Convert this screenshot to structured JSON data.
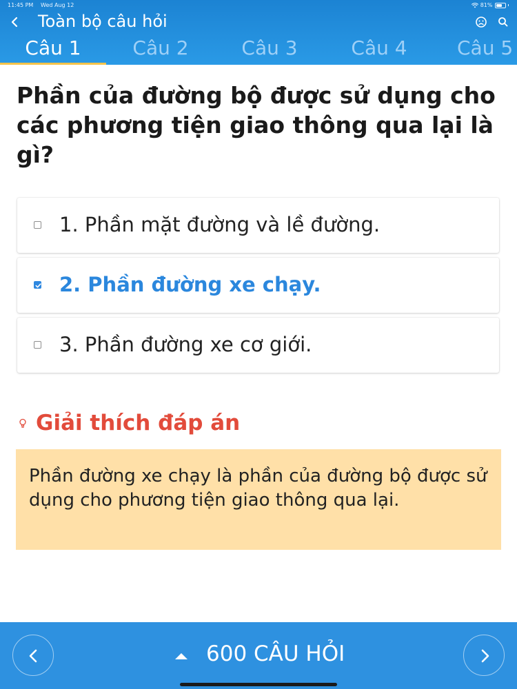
{
  "status_bar": {
    "time": "11:45 PM",
    "date": "Wed Aug 12",
    "battery": "81%",
    "battery_level": 0.81
  },
  "header": {
    "title": "Toàn bộ câu hỏi",
    "icons": [
      "back-chevron-icon",
      "face-icon",
      "search-icon"
    ],
    "tabs": [
      {
        "label": "Câu 1",
        "active": true
      },
      {
        "label": "Câu 2",
        "active": false
      },
      {
        "label": "Câu 3",
        "active": false
      },
      {
        "label": "Câu 4",
        "active": false
      },
      {
        "label": "Câu 5",
        "active": false
      }
    ]
  },
  "question": {
    "text": "Phần của đường bộ được sử dụng cho các phương tiện giao thông qua lại là gì?"
  },
  "answers": [
    {
      "label": "1. Phần mặt đường và lề đường.",
      "checked": false
    },
    {
      "label": "2. Phần đường xe chạy.",
      "checked": true
    },
    {
      "label": "3. Phần đường xe cơ giới.",
      "checked": false
    }
  ],
  "explanation": {
    "title": "Giải thích đáp án",
    "text": "Phần đường xe chạy là phần của đường bộ được sử dụng cho phương tiện giao thông qua lại."
  },
  "bottom_bar": {
    "count_label": "600 CÂU HỎI"
  },
  "colors": {
    "header_blue": "#1c83d3",
    "tab_indicator": "#f5c34a",
    "selected_answer": "#2b87dd",
    "explanation_title": "#e24b3b",
    "explanation_bg": "#ffe0a8",
    "bottom_bar": "#2e91e0"
  }
}
